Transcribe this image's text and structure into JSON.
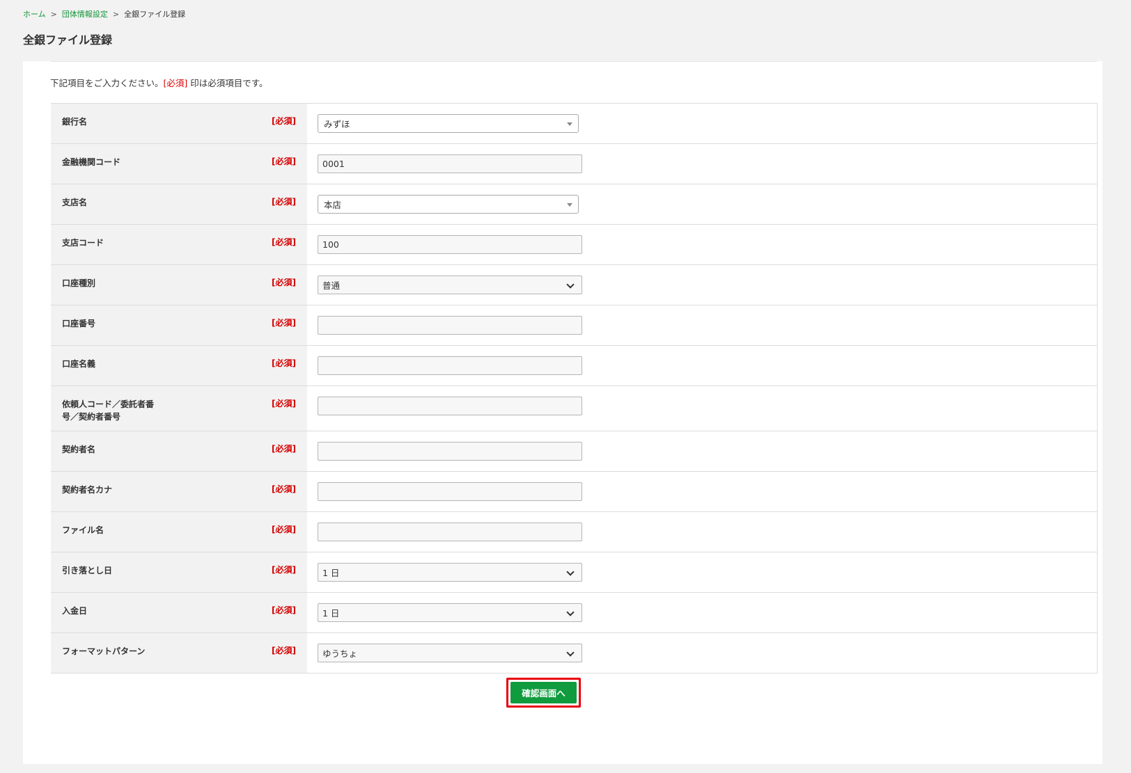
{
  "breadcrumb": {
    "home": "ホーム",
    "separator": ">",
    "settings": "団体情報設定",
    "current": "全銀ファイル登録"
  },
  "page_title": "全銀ファイル登録",
  "intro": {
    "before": "下記項目をご入力ください。",
    "required_mark": "[必須]",
    "after": " 印は必須項目です。"
  },
  "required_tag": "[必須]",
  "fields": {
    "bank_name": {
      "label": "銀行名",
      "value": "みずほ"
    },
    "institution_code": {
      "label": "金融機関コード",
      "value": "0001"
    },
    "branch_name": {
      "label": "支店名",
      "value": "本店"
    },
    "branch_code": {
      "label": "支店コード",
      "value": "100"
    },
    "account_type": {
      "label": "口座種別",
      "value": "普通"
    },
    "account_number": {
      "label": "口座番号",
      "value": ""
    },
    "account_holder": {
      "label": "口座名義",
      "value": ""
    },
    "requester_code": {
      "label": "依頼人コード／委託者番号／契約者番号",
      "value": ""
    },
    "contractor_name": {
      "label": "契約者名",
      "value": ""
    },
    "contractor_kana": {
      "label": "契約者名カナ",
      "value": ""
    },
    "file_name": {
      "label": "ファイル名",
      "value": ""
    },
    "debit_day": {
      "label": "引き落とし日",
      "value": "1 日"
    },
    "deposit_day": {
      "label": "入金日",
      "value": "1 日"
    },
    "format_pattern": {
      "label": "フォーマットパターン",
      "value": "ゆうちょ"
    }
  },
  "submit_label": "確認画面へ",
  "colors": {
    "accent_green": "#0f9b3e",
    "link_green": "#14963a",
    "required_red": "#d40000",
    "highlight_red": "#e8000b"
  }
}
